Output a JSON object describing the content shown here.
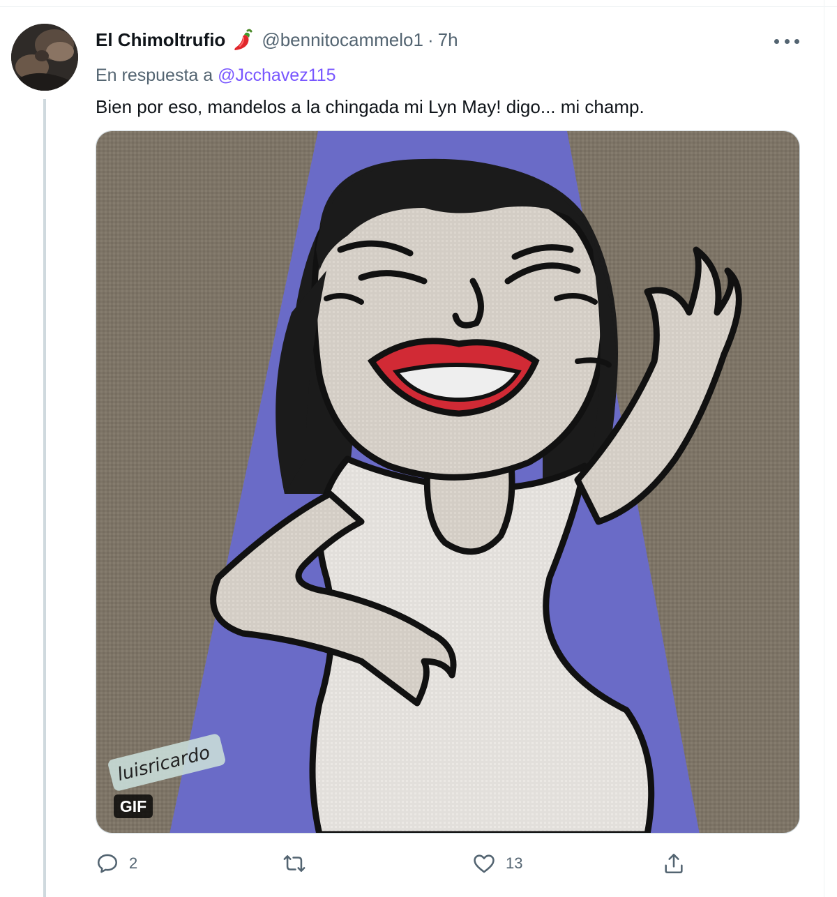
{
  "tweet": {
    "display_name": "El Chimoltrufio",
    "name_emoji": "hot-pepper",
    "handle": "@bennitocammelo1",
    "separator": "·",
    "time": "7h",
    "reply_prefix": "En respuesta a",
    "reply_mention": "@Jcchavez115",
    "text": "Bien por eso, mandelos a la chingada mi Lyn May! digo... mi champ.",
    "media": {
      "badge": "GIF",
      "watermark": "luisricardo"
    },
    "actions": {
      "reply_count": "2",
      "retweet_count": "",
      "like_count": "13"
    }
  },
  "colors": {
    "text": "#0f1419",
    "secondary": "#536471",
    "mention": "#7856ff",
    "gif_bg_brown": "#7d7466",
    "spotlight": "#6a6bc7",
    "lips": "#d12a35"
  },
  "icons": [
    "more-icon",
    "reply-icon",
    "retweet-icon",
    "like-icon",
    "share-icon",
    "hot-pepper-icon"
  ]
}
